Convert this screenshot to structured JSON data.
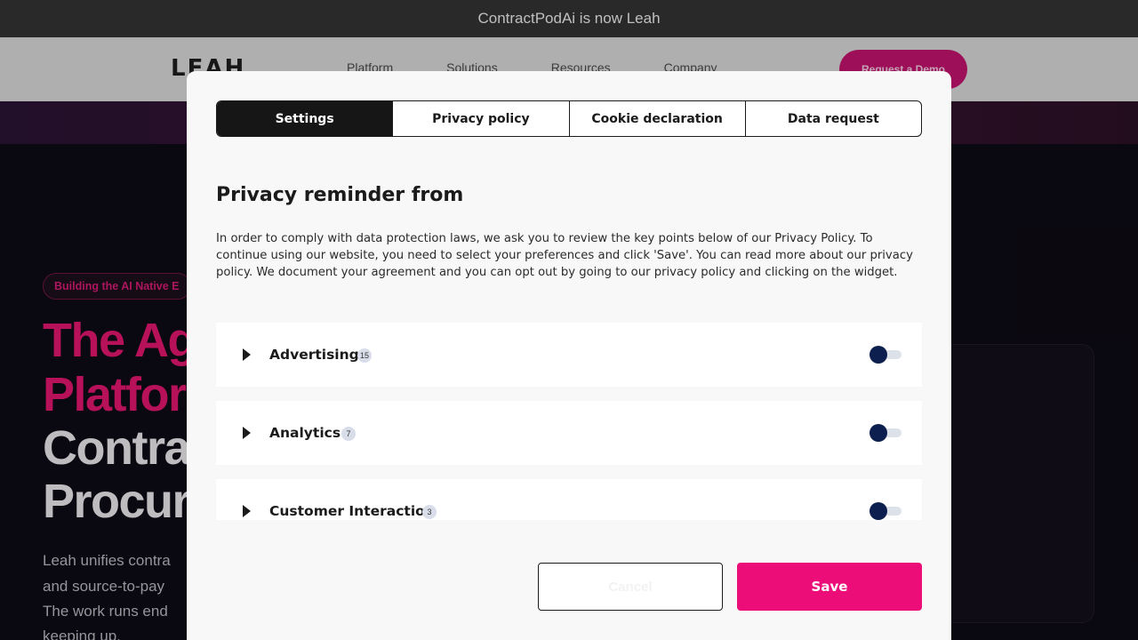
{
  "announcement": "ContractPodAi is now Leah",
  "site": {
    "logo": "LEAH",
    "nav": [
      "Platform",
      "Solutions",
      "Resources",
      "Company"
    ],
    "cta": "Request a Demo"
  },
  "hero": {
    "pill": "Building the AI Native E",
    "line1": "The Ag",
    "line2": "Platfor",
    "line3": "Contra",
    "line4": "Procur",
    "para1": "Leah unifies contra",
    "para2": "and source-to-pay",
    "para3": "The work runs end",
    "para4": "keeping up."
  },
  "modal": {
    "tabs": [
      {
        "label": "Settings",
        "active": true
      },
      {
        "label": "Privacy policy",
        "active": false
      },
      {
        "label": "Cookie declaration",
        "active": false
      },
      {
        "label": "Data request",
        "active": false
      }
    ],
    "title": "Privacy reminder from",
    "description": "In order to comply with data protection laws, we ask you to review the key points below of our Privacy Policy. To continue using our website, you need to select your preferences and click 'Save'. You can read more about our privacy policy. We document your agreement and you can opt out by going to our privacy policy and clicking on the widget.",
    "categories": [
      {
        "name": "Advertising",
        "count": "15",
        "enabled": false
      },
      {
        "name": "Analytics",
        "count": "7",
        "enabled": false
      },
      {
        "name": "Customer Interaction",
        "count": "3",
        "enabled": false
      }
    ],
    "cancel_label": "Cancel",
    "save_label": "Save"
  },
  "colors": {
    "accent": "#ec0d78",
    "toggle_knob": "#0d1f4e",
    "tab_active": "#161616"
  }
}
